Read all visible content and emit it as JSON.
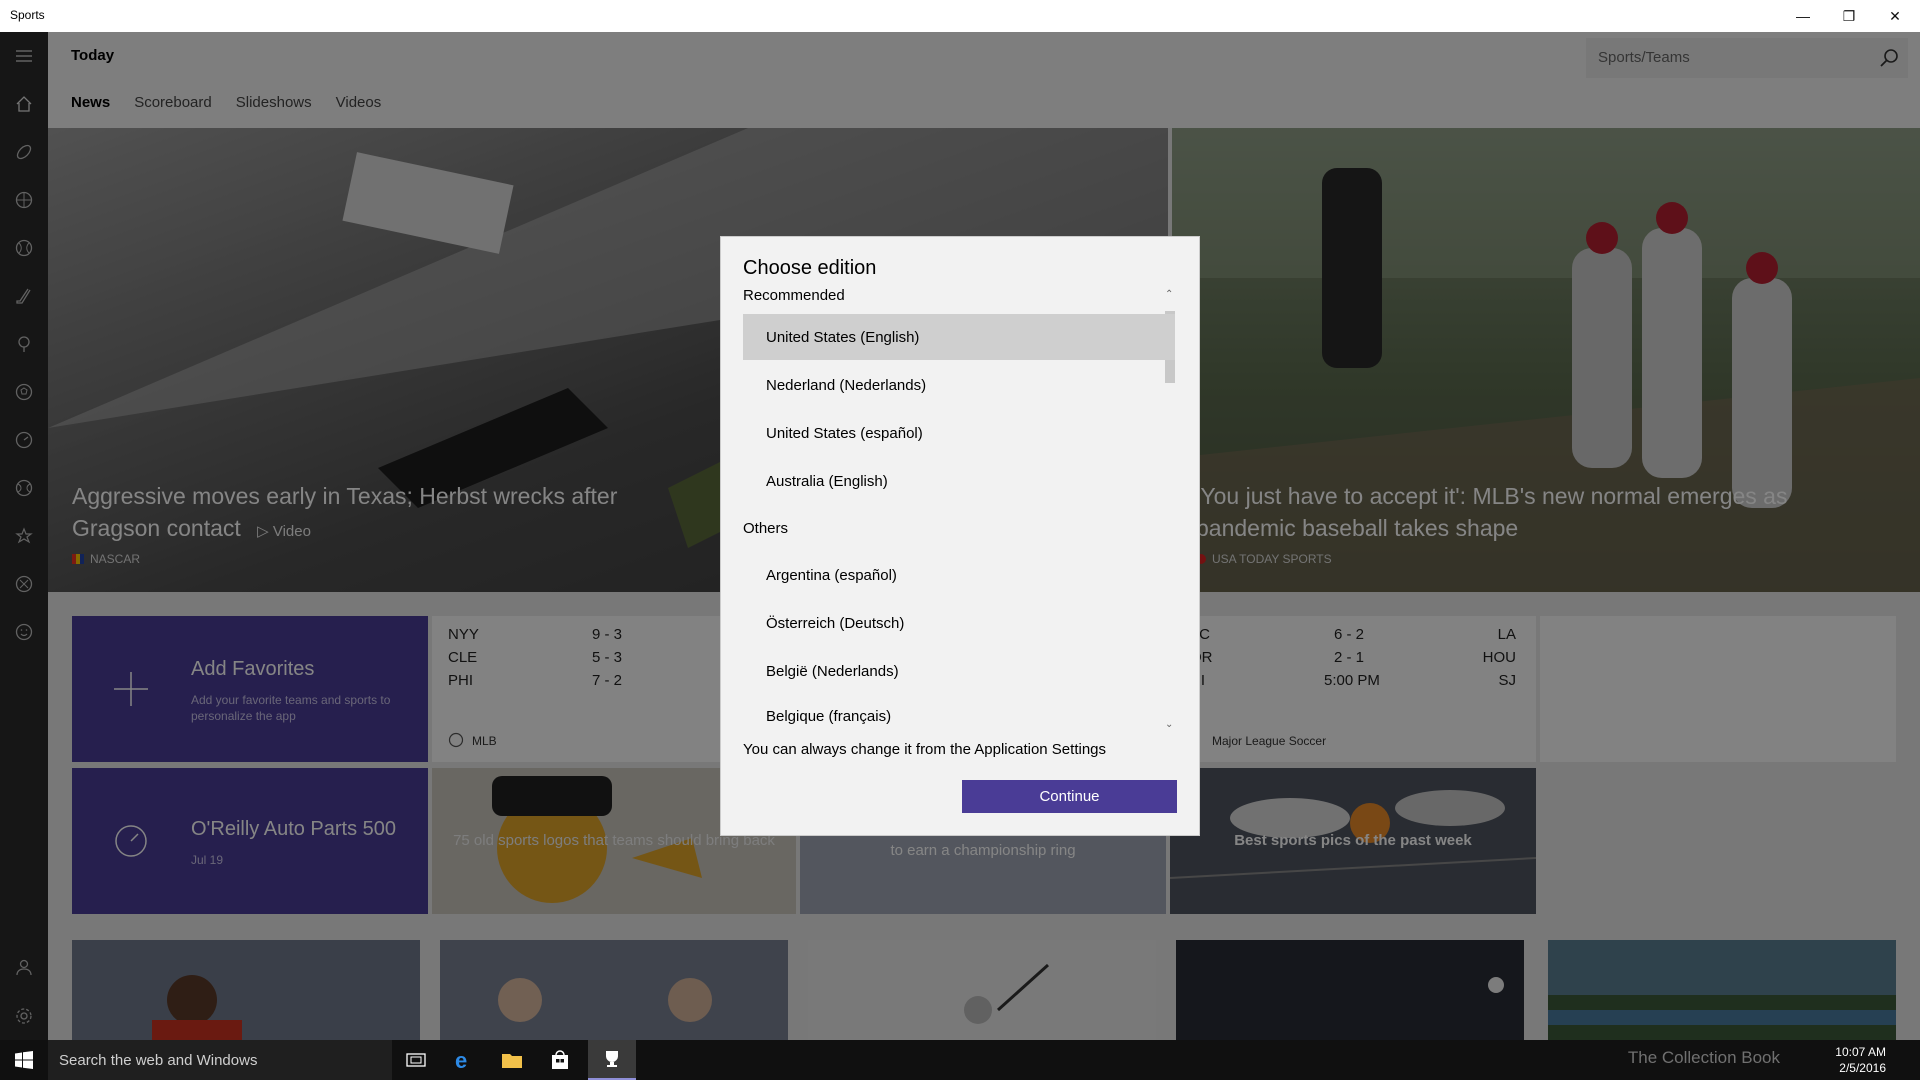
{
  "app": {
    "title": "Sports",
    "window_controls": [
      "minimize-icon",
      "restore-icon",
      "close-icon"
    ]
  },
  "header": {
    "title": "Today",
    "search_placeholder": "Sports/Teams",
    "tabs": [
      {
        "label": "News",
        "active": true
      },
      {
        "label": "Scoreboard",
        "active": false
      },
      {
        "label": "Slideshows",
        "active": false
      },
      {
        "label": "Videos",
        "active": false
      }
    ]
  },
  "sidebar": {
    "icons": [
      "hamburger-icon",
      "home-icon",
      "football-icon",
      "basketball-icon",
      "baseball-icon",
      "hockey-icon",
      "golf-icon",
      "soccer-icon",
      "gauge-icon",
      "tennis-icon",
      "star-icon",
      "more-sports-icon",
      "smiley-icon",
      "account-icon",
      "settings-icon"
    ]
  },
  "hero": {
    "left": {
      "headline": "Aggressive moves early in Texas; Herbst wrecks after Gragson contact",
      "video_label": "Video",
      "source": "NASCAR"
    },
    "right": {
      "headline": "'You just have to accept it': MLB's new normal emerges as pandemic baseball takes shape",
      "source": "USA TODAY SPORTS"
    }
  },
  "tiles": {
    "add_favorites": {
      "title": "Add Favorites",
      "subtitle": "Add your favorite teams and sports to personalize the app"
    },
    "mlb_scores": {
      "league": "MLB",
      "rows": [
        {
          "team": "NYY",
          "score": "9 - 3"
        },
        {
          "team": "CLE",
          "score": "5 - 3"
        },
        {
          "team": "PHI",
          "score": "7 - 2"
        }
      ]
    },
    "mls_scores": {
      "league": "Major League Soccer",
      "rows": [
        {
          "team": "AFC",
          "score": "6 - 2",
          "opp": "LA"
        },
        {
          "team": "POR",
          "score": "2 - 1",
          "opp": "HOU"
        },
        {
          "team": "PHI",
          "score": "5:00 PM",
          "opp": "SJ"
        }
      ]
    },
    "race": {
      "title": "O'Reilly Auto Parts 500",
      "date": "Jul 19"
    },
    "logos_caption": "75 old sports logos that teams should bring back",
    "ring_caption": "to earn a championship ring",
    "pics_caption": "Best sports pics of the past week"
  },
  "dialog": {
    "title": "Choose edition",
    "recommended_label": "Recommended",
    "recommended": [
      "United States (English)",
      "Nederland (Nederlands)",
      "United States (español)",
      "Australia (English)"
    ],
    "selected": "United States (English)",
    "others_label": "Others",
    "others": [
      "Argentina (español)",
      "Österreich (Deutsch)",
      "België (Nederlands)",
      "Belgique (français)"
    ],
    "note": "You can always change it from the Application Settings",
    "continue_label": "Continue"
  },
  "taskbar": {
    "search_placeholder": "Search the web and Windows",
    "time": "10:07 AM",
    "date": "2/5/2016",
    "watermark": "The Collection Book"
  },
  "colors": {
    "accent": "#4a3c96",
    "sidebar": "#2b2b2b",
    "taskbar": "#101010"
  }
}
